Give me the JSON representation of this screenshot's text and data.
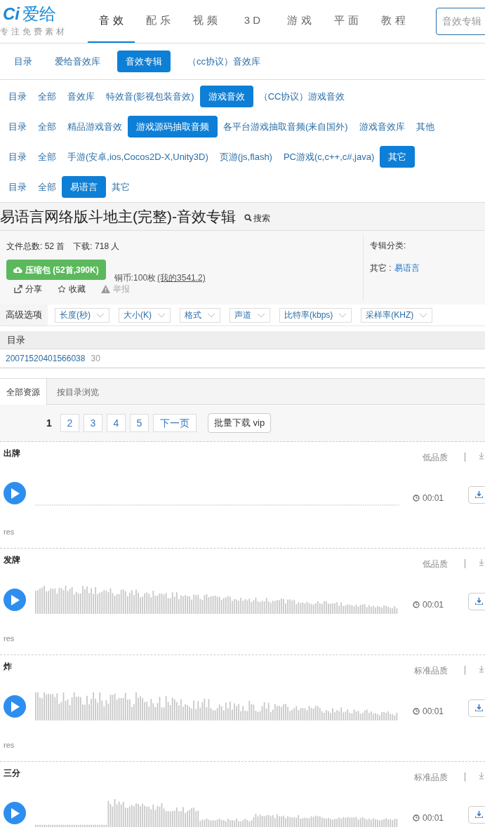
{
  "header": {
    "logo": {
      "mark": "Ci",
      "name": "爱给",
      "tagline": "专注免费素材"
    },
    "nav": [
      {
        "label": "音 效",
        "selected": true
      },
      {
        "label": "配 乐",
        "selected": false
      },
      {
        "label": "视 频",
        "selected": false
      },
      {
        "label": "3 D",
        "selected": false
      },
      {
        "label": "游 戏",
        "selected": false
      },
      {
        "label": "平 面",
        "selected": false
      },
      {
        "label": "教 程",
        "selected": false
      }
    ],
    "search": {
      "placeholder": "音效专辑"
    }
  },
  "category_rows": [
    [
      {
        "label": "目录",
        "selected": false
      },
      {
        "label": "爱给音效库",
        "selected": false
      },
      {
        "label": "音效专辑",
        "selected": true
      },
      {
        "label": "（cc协议）音效库",
        "selected": false
      }
    ],
    [
      {
        "label": "目录",
        "selected": false
      },
      {
        "label": "全部",
        "selected": false
      },
      {
        "label": "音效库",
        "selected": false
      },
      {
        "label": "特效音(影视包装音效)",
        "selected": false
      },
      {
        "label": "游戏音效",
        "selected": true
      },
      {
        "label": "（CC协议）游戏音效",
        "selected": false
      }
    ],
    [
      {
        "label": "目录",
        "selected": false
      },
      {
        "label": "全部",
        "selected": false
      },
      {
        "label": "精品游戏音效",
        "selected": false
      },
      {
        "label": "游戏源码抽取音频",
        "selected": true
      },
      {
        "label": "各平台游戏抽取音频(来自国外)",
        "selected": false
      },
      {
        "label": "游戏音效库",
        "selected": false
      },
      {
        "label": "其他",
        "selected": false
      }
    ],
    [
      {
        "label": "目录",
        "selected": false
      },
      {
        "label": "全部",
        "selected": false
      },
      {
        "label": "手游(安卓,ios,Cocos2D-X,Unity3D)",
        "selected": false
      },
      {
        "label": "页游(js,flash)",
        "selected": false
      },
      {
        "label": "PC游戏(c,c++,c#,java)",
        "selected": false
      },
      {
        "label": "其它",
        "selected": true
      }
    ],
    [
      {
        "label": "目录",
        "selected": false
      },
      {
        "label": "全部",
        "selected": false
      },
      {
        "label": "易语言",
        "selected": true
      },
      {
        "label": "其它",
        "selected": false
      }
    ]
  ],
  "album": {
    "title": "易语言网络版斗地主(完整)-音效专辑",
    "search_link": "搜索",
    "file_count": "文件总数: 52 首",
    "downloads": "下载: 718 人",
    "download_button": "压缩包 (52首,390K)",
    "coins": "铜币:100枚",
    "my_coins": "(我的3541.2)",
    "actions": [
      {
        "kind": "share",
        "label": "分享",
        "disabled": false
      },
      {
        "kind": "star",
        "label": "收藏",
        "disabled": false
      },
      {
        "kind": "warning",
        "label": "举报",
        "disabled": true
      }
    ],
    "category_label": "专辑分类:",
    "category_parent": "其它 :",
    "category_link": "易语言"
  },
  "filters": {
    "label": "高级选项",
    "dropdowns": [
      "长度(秒)",
      "大小(K)",
      "格式",
      "声道",
      "比特率(kbps)",
      "采样率(KHZ)"
    ]
  },
  "directory": {
    "header": "目录",
    "rows": [
      {
        "name": "20071520401566038",
        "count": "30"
      }
    ]
  },
  "tabs": [
    {
      "label": "全部资源",
      "selected": true
    },
    {
      "label": "按目录浏览",
      "selected": false
    }
  ],
  "pagination": {
    "pages": [
      {
        "label": "1",
        "selected": true
      },
      {
        "label": "2",
        "selected": false
      },
      {
        "label": "3",
        "selected": false
      },
      {
        "label": "4",
        "selected": false
      },
      {
        "label": "5",
        "selected": false
      }
    ],
    "next": "下一页",
    "batch": "批量下载 vip"
  },
  "tracks": [
    {
      "name": "出牌",
      "quality": "低品质",
      "duration": "00:01",
      "folder": "res",
      "kind": "silent"
    },
    {
      "name": "发牌",
      "quality": "低品质",
      "duration": "00:01",
      "folder": "res",
      "kind": "wave"
    },
    {
      "name": "炸",
      "quality": "标准品质",
      "duration": "00:01",
      "folder": "res",
      "kind": "wave"
    },
    {
      "name": "三分",
      "quality": "标准品质",
      "duration": "00:01",
      "kind": "wave"
    }
  ]
}
